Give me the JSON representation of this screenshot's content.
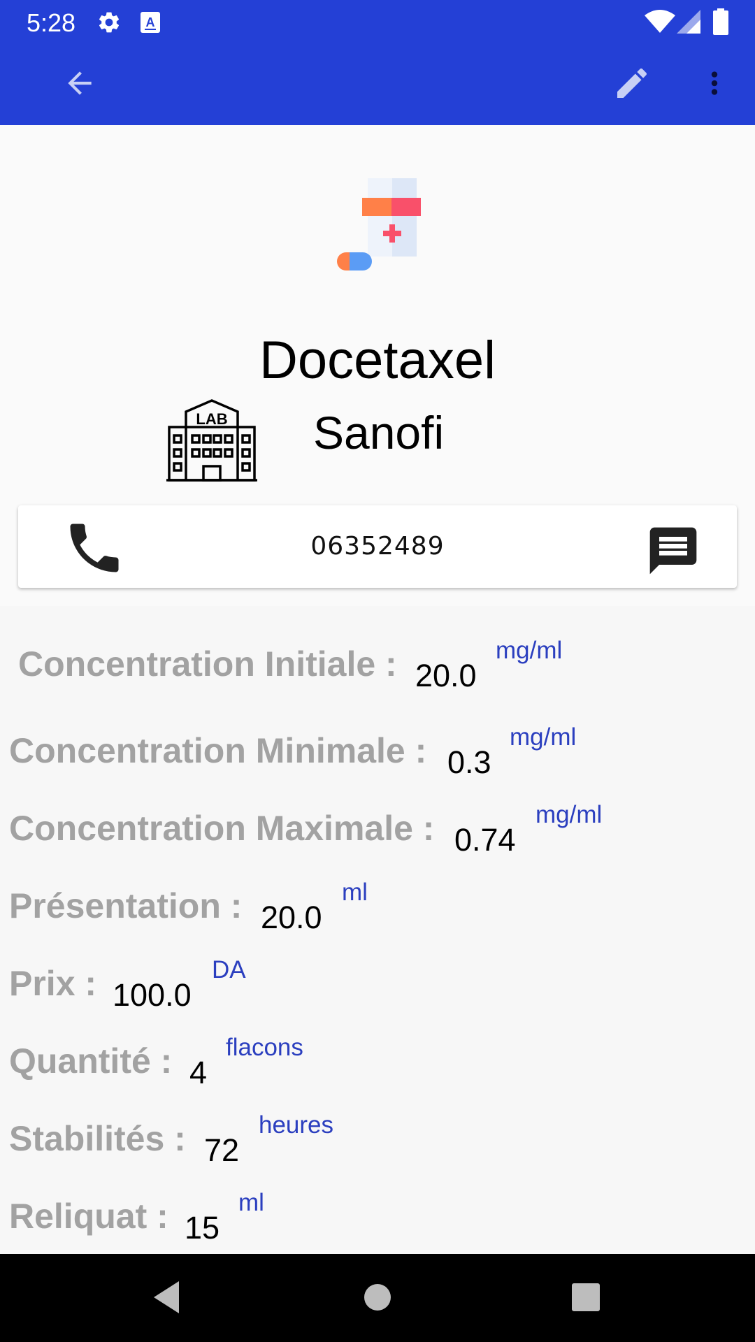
{
  "status_bar": {
    "time": "5:28",
    "icons": [
      "settings-icon",
      "keyboard-a-icon",
      "wifi-icon",
      "signal-icon",
      "battery-icon"
    ]
  },
  "app_bar": {
    "icons": [
      "back-arrow-icon",
      "edit-pencil-icon",
      "more-vert-icon"
    ],
    "color": "#2440d6"
  },
  "product": {
    "icon": "medicine-bottle-icon",
    "name": "Docetaxel",
    "lab_icon": "lab-building-icon",
    "lab_name": "Sanofi"
  },
  "contact": {
    "phone": "06352489",
    "icons": [
      "phone-icon",
      "message-icon"
    ]
  },
  "details": [
    {
      "label": "Concentration Initiale :",
      "value": "20.0",
      "unit": "mg/ml"
    },
    {
      "label": "Concentration Minimale :",
      "value": "0.3",
      "unit": "mg/ml"
    },
    {
      "label": "Concentration Maximale :",
      "value": "0.74",
      "unit": "mg/ml"
    },
    {
      "label": "Présentation :",
      "value": "20.0",
      "unit": "ml"
    },
    {
      "label": "Prix :",
      "value": "100.0",
      "unit": "DA"
    },
    {
      "label": "Quantité :",
      "value": "4",
      "unit": "flacons"
    },
    {
      "label": "Stabilités :",
      "value": "72",
      "unit": "heures"
    },
    {
      "label": "Reliquat :",
      "value": "15",
      "unit": "ml"
    }
  ],
  "nav_bar": {
    "icons": [
      "nav-back-icon",
      "nav-home-icon",
      "nav-recents-icon"
    ]
  },
  "colors": {
    "primary": "#2440d6",
    "label_gray": "#a2a2a2",
    "unit_blue": "#2b3fbf"
  }
}
